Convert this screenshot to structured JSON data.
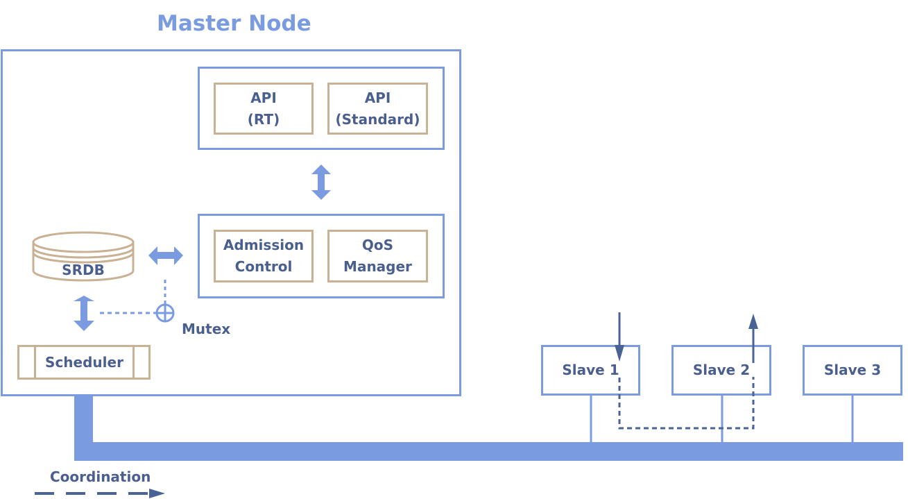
{
  "diagram": {
    "master_node": {
      "title": "Master Node",
      "api_group": {
        "boxes": [
          {
            "line1": "API",
            "line2": "(RT)"
          },
          {
            "line1": "API",
            "line2": "(Standard)"
          }
        ]
      },
      "control_group": {
        "boxes": [
          {
            "line1": "Admission",
            "line2": "Control"
          },
          {
            "line1": "QoS",
            "line2": "Manager"
          }
        ]
      },
      "database": {
        "label": "SRDB"
      },
      "scheduler": {
        "label": "Scheduler"
      },
      "mutex": {
        "label": "Mutex"
      }
    },
    "slaves": [
      {
        "label": "Slave 1"
      },
      {
        "label": "Slave 2"
      },
      {
        "label": "Slave 3"
      }
    ],
    "legend": {
      "label": "Coordination"
    },
    "colors": {
      "primary_blue": "#7b9be0",
      "tan": "#c9b194",
      "text_dark": "#4a5f8e"
    }
  }
}
